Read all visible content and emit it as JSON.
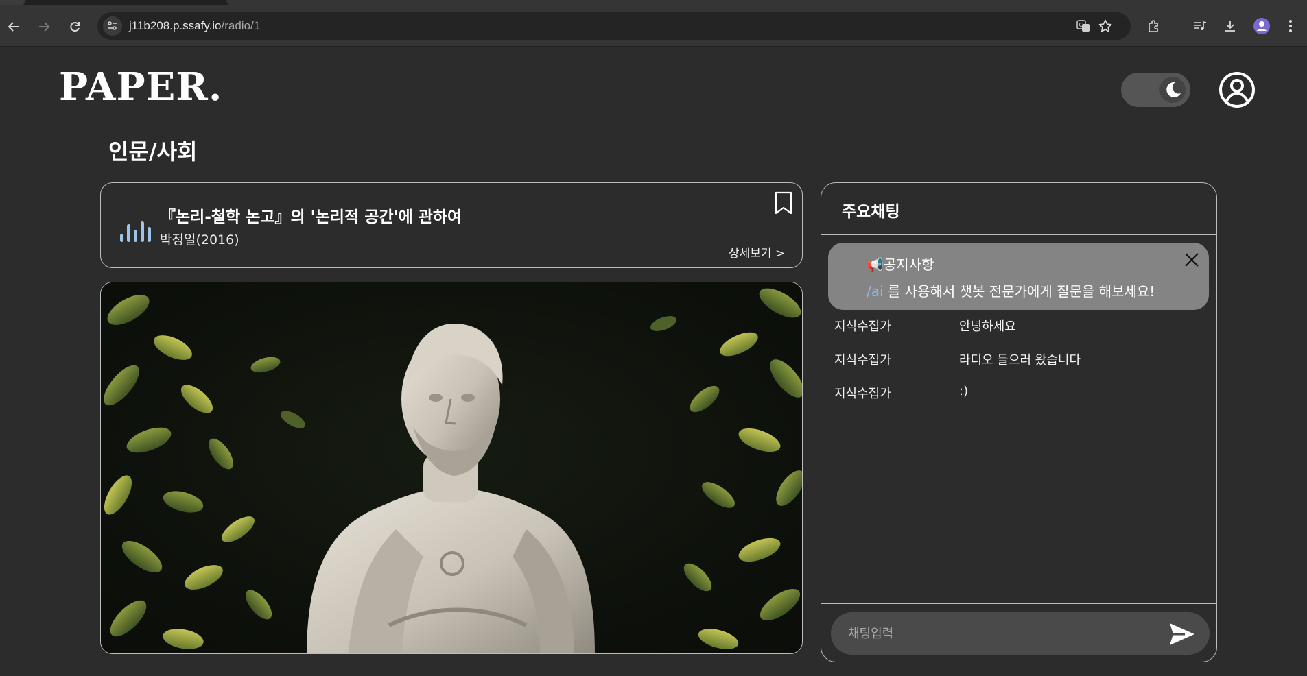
{
  "browser": {
    "url_host": "j11b208.p.ssafy.io",
    "url_path": "/radio/1"
  },
  "header": {
    "logo": "PAPER.",
    "theme_toggle": "dark"
  },
  "page": {
    "category_title": "인문/사회"
  },
  "radio": {
    "title": "『논리-철학 논고』의 '논리적 공간'에 관하여",
    "author": "박정일(2016)",
    "detail_link": "상세보기 >"
  },
  "chat": {
    "title": "주요채팅",
    "notice": {
      "title": "📢공지사항",
      "command": "/ai",
      "body": " 를 사용해서 챗봇 전문가에게 질문을 해보세요!"
    },
    "messages": [
      {
        "user": "지식수집가",
        "text": "안녕하세요"
      },
      {
        "user": "지식수집가",
        "text": "라디오 들으러 왔습니다"
      },
      {
        "user": "지식수집가",
        "text": ":)"
      }
    ],
    "input_placeholder": "채팅입력"
  },
  "colors": {
    "background": "#2c2c2c",
    "notice_bg": "#848484",
    "equalizer": "#9ec5e8",
    "command_link": "#8fb8e6"
  }
}
